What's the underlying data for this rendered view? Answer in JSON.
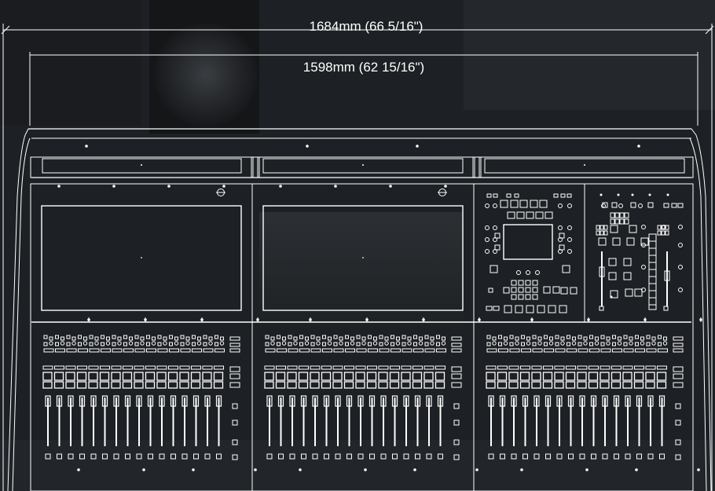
{
  "dimensions": {
    "overall_width": "1684mm (66 5/16\")",
    "frame_width": "1598mm (62 15/16\")"
  },
  "console": {
    "fader_bays": 3,
    "faders_per_bay": 16,
    "touch_screens": 2,
    "master_section_panels": 2
  },
  "colors": {
    "background": "#1b1e22",
    "line": "#ffffff"
  }
}
